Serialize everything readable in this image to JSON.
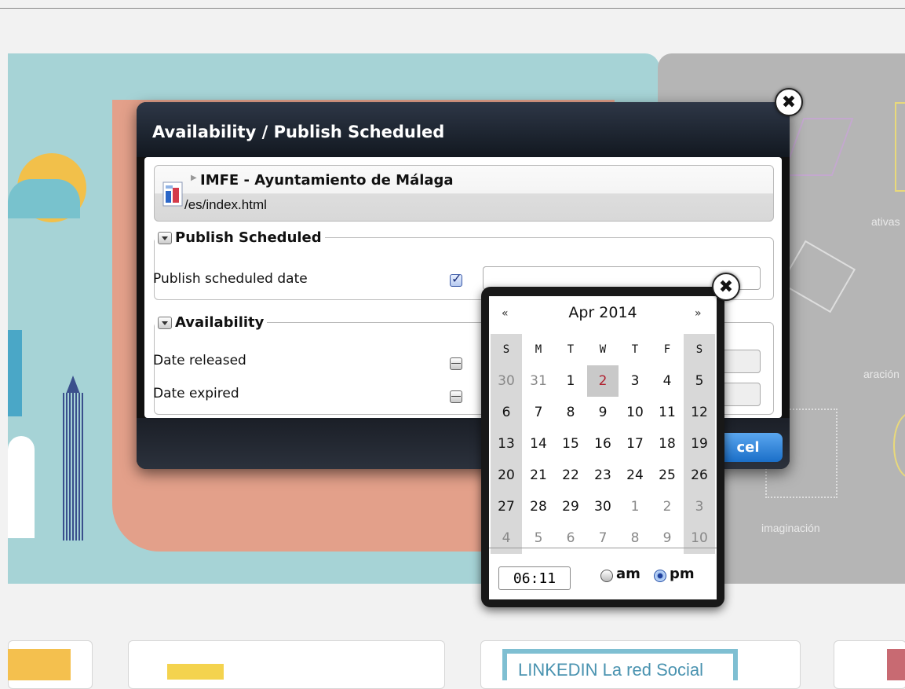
{
  "dialog": {
    "title": "Availability / Publish Scheduled",
    "site": {
      "name": "IMFE - Ayuntamiento de Málaga",
      "path": "/es/index.html"
    },
    "publish_section": {
      "legend": "Publish Scheduled",
      "field_label": "Publish scheduled date",
      "checked": true,
      "value": ""
    },
    "availability_section": {
      "legend": "Availability",
      "released_label": "Date released",
      "expired_label": "Date expired"
    },
    "cancel_label": "cel"
  },
  "calendar": {
    "prev": "«",
    "next": "»",
    "month_label": "Apr 2014",
    "weekdays": [
      "S",
      "M",
      "T",
      "W",
      "T",
      "F",
      "S"
    ],
    "weeks": [
      [
        "30",
        "31",
        "1",
        "2",
        "3",
        "4",
        "5"
      ],
      [
        "6",
        "7",
        "8",
        "9",
        "10",
        "11",
        "12"
      ],
      [
        "13",
        "14",
        "15",
        "16",
        "17",
        "18",
        "19"
      ],
      [
        "20",
        "21",
        "22",
        "23",
        "24",
        "25",
        "26"
      ],
      [
        "27",
        "28",
        "29",
        "30",
        "1",
        "2",
        "3"
      ],
      [
        "4",
        "5",
        "6",
        "7",
        "8",
        "9",
        "10"
      ]
    ],
    "today": "2",
    "time": "06:11",
    "am_label": "am",
    "pm_label": "pm",
    "selected_period": "pm"
  },
  "background": {
    "labels": [
      "ativas",
      "aración",
      "imaginación"
    ],
    "banner": "LINKEDIN  La red Social"
  },
  "colors": {
    "teal": "#a6d3d6",
    "salmon": "#e3a08a",
    "accent_blue": "#1b6fc8"
  }
}
